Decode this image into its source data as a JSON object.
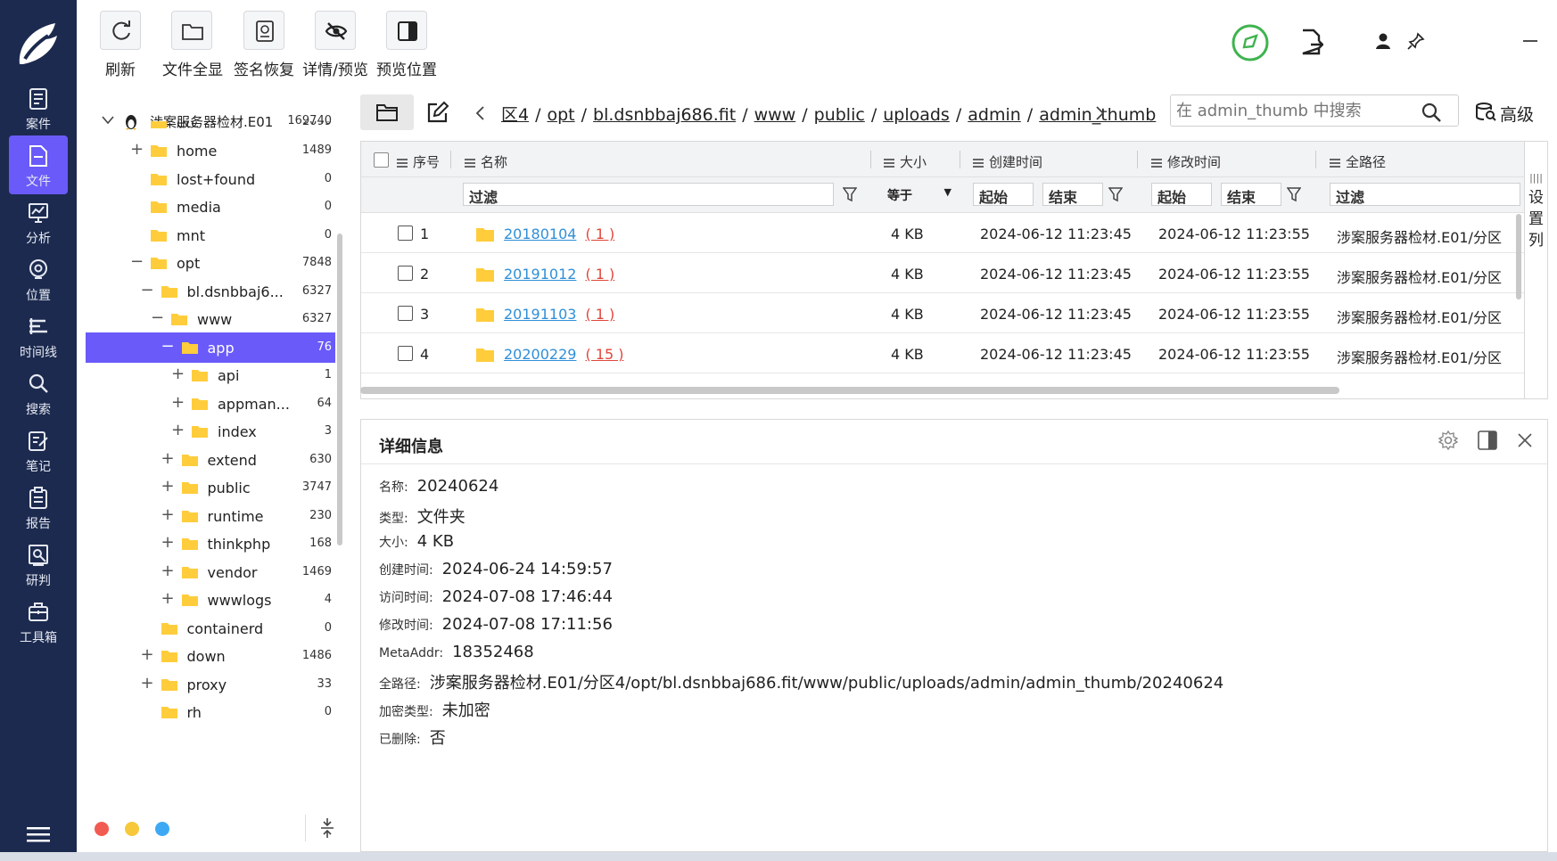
{
  "toolbar": {
    "buttons": [
      {
        "label": "刷新",
        "icon": "refresh-icon"
      },
      {
        "label": "文件全显",
        "icon": "folder-icon"
      },
      {
        "label": "签名恢复",
        "icon": "signature-icon"
      },
      {
        "label": "详情/预览",
        "icon": "eye-off-icon"
      },
      {
        "label": "预览位置",
        "icon": "layout-panel-icon"
      }
    ]
  },
  "nav": {
    "items": [
      {
        "label": "案件",
        "icon": "case-icon"
      },
      {
        "label": "文件",
        "icon": "file-icon",
        "active": true
      },
      {
        "label": "分析",
        "icon": "analysis-icon"
      },
      {
        "label": "位置",
        "icon": "location-icon"
      },
      {
        "label": "时间线",
        "icon": "timeline-icon"
      },
      {
        "label": "搜索",
        "icon": "search-icon"
      },
      {
        "label": "笔记",
        "icon": "note-icon"
      },
      {
        "label": "报告",
        "icon": "report-icon"
      },
      {
        "label": "研判",
        "icon": "judge-icon"
      },
      {
        "label": "工具箱",
        "icon": "toolbox-icon"
      }
    ]
  },
  "tree": {
    "root": {
      "name": "涉案服务器检材.E01",
      "count": "169740"
    },
    "items": [
      {
        "name": "etc",
        "count": "2099",
        "toggle": "",
        "level": 1
      },
      {
        "name": "home",
        "count": "1489",
        "toggle": "+",
        "level": 1
      },
      {
        "name": "lost+found",
        "count": "0",
        "toggle": "",
        "level": 1
      },
      {
        "name": "media",
        "count": "0",
        "toggle": "",
        "level": 1
      },
      {
        "name": "mnt",
        "count": "0",
        "toggle": "",
        "level": 1
      },
      {
        "name": "opt",
        "count": "7848",
        "toggle": "−",
        "level": 1
      },
      {
        "name": "bl.dsnbbaj6...",
        "count": "6327",
        "toggle": "−",
        "level": 2
      },
      {
        "name": "www",
        "count": "6327",
        "toggle": "−",
        "level": 3
      },
      {
        "name": "app",
        "count": "76",
        "toggle": "−",
        "level": 4,
        "selected": true
      },
      {
        "name": "api",
        "count": "1",
        "toggle": "+",
        "level": 5
      },
      {
        "name": "appman...",
        "count": "64",
        "toggle": "+",
        "level": 5
      },
      {
        "name": "index",
        "count": "3",
        "toggle": "+",
        "level": 5
      },
      {
        "name": "extend",
        "count": "630",
        "toggle": "+",
        "level": 4
      },
      {
        "name": "public",
        "count": "3747",
        "toggle": "+",
        "level": 4
      },
      {
        "name": "runtime",
        "count": "230",
        "toggle": "+",
        "level": 4
      },
      {
        "name": "thinkphp",
        "count": "168",
        "toggle": "+",
        "level": 4
      },
      {
        "name": "vendor",
        "count": "1469",
        "toggle": "+",
        "level": 4
      },
      {
        "name": "wwwlogs",
        "count": "4",
        "toggle": "+",
        "level": 4
      },
      {
        "name": "containerd",
        "count": "0",
        "toggle": "",
        "level": 2
      },
      {
        "name": "down",
        "count": "1486",
        "toggle": "+",
        "level": 2
      },
      {
        "name": "proxy",
        "count": "33",
        "toggle": "+",
        "level": 2
      },
      {
        "name": "rh",
        "count": "0",
        "toggle": "",
        "level": 2
      }
    ]
  },
  "path": {
    "segments": [
      "区4",
      "opt",
      "bl.dsnbbaj686.fit",
      "www",
      "public",
      "uploads",
      "admin",
      "admin_thumb"
    ],
    "sep": "/",
    "search_placeholder": "在 admin_thumb 中搜索",
    "advanced_label": "高级"
  },
  "grid": {
    "headers": [
      "序号",
      "名称",
      "大小",
      "创建时间",
      "修改时间",
      "全路径"
    ],
    "filter": {
      "name": "过滤",
      "size_op": "等于",
      "start": "起始",
      "end": "结束",
      "mstart": "起始",
      "mend": "结束",
      "path": "过滤"
    },
    "rows": [
      {
        "idx": "1",
        "name": "20180104",
        "count": "( 1 )",
        "size": "4 KB",
        "created": "2024-06-12 11:23:45",
        "modified": "2024-06-12 11:23:55",
        "path": "涉案服务器检材.E01/分区"
      },
      {
        "idx": "2",
        "name": "20191012",
        "count": "( 1 )",
        "size": "4 KB",
        "created": "2024-06-12 11:23:45",
        "modified": "2024-06-12 11:23:55",
        "path": "涉案服务器检材.E01/分区"
      },
      {
        "idx": "3",
        "name": "20191103",
        "count": "( 1 )",
        "size": "4 KB",
        "created": "2024-06-12 11:23:45",
        "modified": "2024-06-12 11:23:55",
        "path": "涉案服务器检材.E01/分区"
      },
      {
        "idx": "4",
        "name": "20200229",
        "count": "( 15 )",
        "size": "4 KB",
        "created": "2024-06-12 11:23:45",
        "modified": "2024-06-12 11:23:55",
        "path": "涉案服务器检材.E01/分区"
      }
    ],
    "settings_label": "设置列"
  },
  "detail": {
    "title": "详细信息",
    "fields": [
      {
        "k": "名称:",
        "v": "20240624"
      },
      {
        "k": "类型:",
        "v": "文件夹"
      },
      {
        "k": "大小:",
        "v": "4 KB"
      },
      {
        "k": "创建时间:",
        "v": "2024-06-24 14:59:57"
      },
      {
        "k": "访问时间:",
        "v": "2024-07-08 17:46:44"
      },
      {
        "k": "修改时间:",
        "v": "2024-07-08 17:11:56"
      },
      {
        "k": "MetaAddr:",
        "v": "18352468"
      },
      {
        "k": "全路径:",
        "v": "涉案服务器检材.E01/分区4/opt/bl.dsnbbaj686.fit/www/public/uploads/admin/admin_thumb/20240624"
      },
      {
        "k": "加密类型:",
        "v": "未加密"
      },
      {
        "k": "已删除:",
        "v": "否"
      }
    ]
  },
  "colors": {
    "nav_bg": "#1c2a4f",
    "accent": "#6a5af9",
    "folder": "#ffcd3c",
    "link": "#2f8fd8",
    "count": "#e0463a",
    "status_green": "#3fb34f"
  }
}
